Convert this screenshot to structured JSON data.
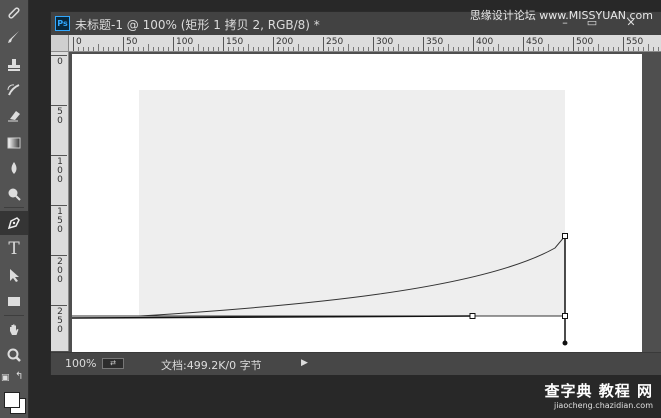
{
  "document": {
    "title": "未标题-1 @ 100% (矩形 1 拷贝 2, RGB/8) *",
    "app_logo": "Ps",
    "canvas_color": "#ffffff",
    "shape_color": "#eeeeee"
  },
  "rulers": {
    "top_labels": [
      "0",
      "50",
      "100",
      "150",
      "200",
      "250",
      "300",
      "350",
      "400",
      "450",
      "500",
      "550"
    ],
    "left_labels": [
      "0",
      "50",
      "100",
      "150",
      "200",
      "250"
    ]
  },
  "statusbar": {
    "zoom": "100%",
    "doc_size": "文档:499.2K/0 字节",
    "menu_arrow": "▶"
  },
  "window_controls": {
    "minimize": "–",
    "maximize": "▭",
    "close": "✕"
  },
  "tools": [
    {
      "name": "healing-brush-icon",
      "active": false
    },
    {
      "name": "brush-icon",
      "active": false
    },
    {
      "name": "clone-stamp-icon",
      "active": false
    },
    {
      "name": "history-brush-icon",
      "active": false
    },
    {
      "name": "eraser-icon",
      "active": false
    },
    {
      "name": "gradient-icon",
      "active": false
    },
    {
      "name": "blur-icon",
      "active": false
    },
    {
      "name": "dodge-icon",
      "active": false
    },
    {
      "name": "pen-icon",
      "active": true
    },
    {
      "name": "type-icon",
      "active": false,
      "glyph": "T"
    },
    {
      "name": "path-selection-icon",
      "active": false
    },
    {
      "name": "rectangle-icon",
      "active": false
    },
    {
      "name": "hand-icon",
      "active": false
    },
    {
      "name": "zoom-icon",
      "active": false
    }
  ],
  "watermark": {
    "top": "思缘设计论坛 www.MISSYUAN.com",
    "bottom_main": "查字典 教程 网",
    "bottom_url": "jiaocheng.chazidian.com"
  }
}
